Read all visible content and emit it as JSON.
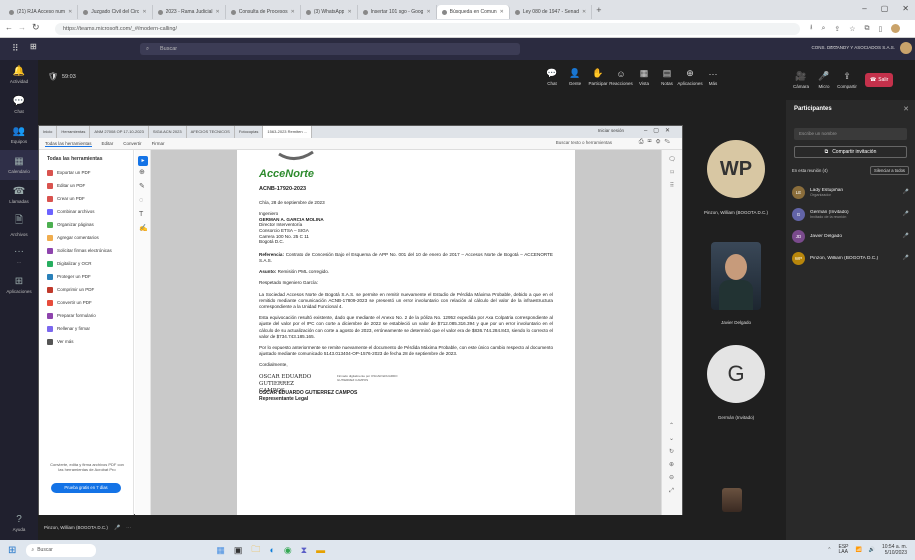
{
  "browser": {
    "tabs": [
      {
        "label": "(21) RJA Acceso num",
        "active": false
      },
      {
        "label": "Juzgado Civil del Circ",
        "active": false
      },
      {
        "label": "2023 - Rama Judicial",
        "active": false
      },
      {
        "label": "Consulta de Procesos",
        "active": false
      },
      {
        "label": "(3) WhatsApp",
        "active": false
      },
      {
        "label": "Insertar 101 sgo - Goog",
        "active": false
      },
      {
        "label": "Búsqueda en Comun",
        "active": true
      },
      {
        "label": "Ley 080 de 1947 - Senad",
        "active": false
      }
    ],
    "url": "https://teams.microsoft.com/_#/modern-calling/"
  },
  "teams": {
    "search_placeholder": "Buscar",
    "org_name": "CONS. DEGANDY Y ASOCIADOS S.A.S.",
    "timer": "59:03",
    "rail": [
      {
        "label": "Actividad",
        "icon": "bell-icon"
      },
      {
        "label": "Chat",
        "icon": "chat-icon"
      },
      {
        "label": "Equipos",
        "icon": "teams-icon"
      },
      {
        "label": "Calendario",
        "icon": "calendar-icon"
      },
      {
        "label": "Llamadas",
        "icon": "phone-icon"
      },
      {
        "label": "Archivos",
        "icon": "file-icon"
      },
      {
        "label": "...",
        "icon": "more-icon"
      },
      {
        "label": "Aplicaciones",
        "icon": "apps-icon"
      }
    ],
    "rail_help": "Ayuda",
    "toolbar": [
      {
        "label": "Chat",
        "icon": "chat-icon"
      },
      {
        "label": "Gente",
        "icon": "people-icon"
      },
      {
        "label": "Participar",
        "icon": "raise-hand-icon"
      },
      {
        "label": "Reacciones",
        "icon": "emoji-icon"
      },
      {
        "label": "Vista",
        "icon": "grid-icon"
      },
      {
        "label": "Notas",
        "icon": "notes-icon"
      },
      {
        "label": "Aplicaciones",
        "icon": "apps-icon"
      },
      {
        "label": "Más",
        "icon": "more-icon"
      }
    ],
    "media": [
      {
        "label": "Cámara",
        "icon": "camera-icon"
      },
      {
        "label": "Micro",
        "icon": "mic-icon"
      },
      {
        "label": "Compartir",
        "icon": "share-icon"
      }
    ],
    "leave_label": "Salir",
    "presenter_bottom": "Pinzon, William (BOGOTA D.C.)",
    "colors": {
      "leave": "#c4314b",
      "accent": "#5b5fc7",
      "acce": "#2e8b2e"
    }
  },
  "participants": {
    "title": "Participantes",
    "search_placeholder": "Escribe un nombre",
    "invite_label": "Compartir invitación",
    "section": "En esta reunión (4)",
    "mute_all": "Silenciar a todos",
    "people": [
      {
        "initials": "LE",
        "name": "Lady Estupiñan",
        "role": "Organizador",
        "color": "#8a6d3b"
      },
      {
        "initials": "G",
        "name": "Germán (Invitado)",
        "role": "Invitado de la reunión",
        "color": "#6264a7"
      },
      {
        "initials": "JD",
        "name": "Javier Delgado",
        "role": "",
        "color": "#7a4a8c"
      },
      {
        "initials": "WP",
        "name": "Pinzon, William (BOGOTA D.C.)",
        "role": "",
        "color": "#b8860b"
      }
    ]
  },
  "tiles": [
    {
      "initials": "WP",
      "name": "Pinzon, William (BOGOTA D.C.)",
      "type": "avatar",
      "color": "#d8c7a3"
    },
    {
      "initials": "",
      "name": "Javier Delgado",
      "type": "video",
      "color": "#556"
    },
    {
      "initials": "G",
      "name": "Germán (Invitado)",
      "type": "avatar",
      "color": "#e4e4e4"
    }
  ],
  "shared": {
    "tabs": [
      "Inicio",
      "Herramientas",
      "ANM 27008 OP 17-10-2023",
      "SIGA ACN 2023",
      "AFECIOS TECNICOS",
      "Fotocopias",
      "1563-2023 Remiten ..."
    ],
    "tab_active": "1563-2023 Remiten ...",
    "login_label": "Iniciar sesión",
    "menu": [
      "Todas las herramientas",
      "Editar",
      "Convertir",
      "Firmar"
    ],
    "find_label": "Buscar texto o herramientas",
    "tools_title": "Todas las herramientas",
    "tools": [
      {
        "label": "Exportar un PDF",
        "color": "#d9534f"
      },
      {
        "label": "Editar un PDF",
        "color": "#d9534f"
      },
      {
        "label": "Crear un PDF",
        "color": "#d9534f"
      },
      {
        "label": "Combinar archivos",
        "color": "#6c63ff"
      },
      {
        "label": "Organizar páginas",
        "color": "#4caf50"
      },
      {
        "label": "Agregar comentarios",
        "color": "#f0ad4e"
      },
      {
        "label": "Solicitar firmas electrónicas",
        "color": "#8e44ad"
      },
      {
        "label": "Digitalizar y OCR",
        "color": "#27ae60"
      },
      {
        "label": "Proteger un PDF",
        "color": "#2980b9"
      },
      {
        "label": "Comprimir un PDF",
        "color": "#c0392b"
      },
      {
        "label": "Convertir un PDF",
        "color": "#e74c3c"
      },
      {
        "label": "Preparar formulario",
        "color": "#8e44ad"
      },
      {
        "label": "Rellenar y firmar",
        "color": "#7b68ee"
      },
      {
        "label": "Ver más",
        "color": "#555"
      }
    ],
    "promo_text": "Convierte, edita y firma archivos PDF con las herramientas de Acrobat Pro",
    "promo_button": "Prueba gratis en 7 días"
  },
  "doc": {
    "logo": "AcceNorte",
    "ref_code": "ACNB-17920-2023",
    "date": "Chía, 28 de septiembre de 2023",
    "addr": [
      "Ingeniero",
      "GERMAN A. GARCIA MOLINA",
      "Director Interventoría",
      "Consorcio ETSA – SIGA",
      "Carrera 100 No. 25 C 11",
      "Bogotá D.C."
    ],
    "ref_label": "Referencia:",
    "ref_text": "Contrato de Concesión Bajo el Esquema de APP No. 001 del 10 de enero de 2017 – Accesos Norte de Bogotá – ACCENORTE S.A.S.",
    "subject_label": "Asunto:",
    "subject_text": "Remisión PML corregido.",
    "greeting": "Respetado Ingeniero García:",
    "p1": "La Sociedad Accesos Norte de Bogotá S.A.S. se permite en remitir nuevamente el Estudio de Pérdida Máxima Probable, debido a que en el remitido mediante comunicación ACNB-17809-2023 se presentó un error involuntario con relación al cálculo del valor de la infraestructura correspondiente a la Unidad Funcional 4.",
    "p2": "Esta equivocación resultó existente, dado que mediante el Anexo No. 2 de la póliza No. 12952 expedida por Axa Colpatria correspondiente al ajuste del valor por el IPC con corte a diciembre de 2022 se estableció un valor de $712.085.316.394 y que por un error involuntario en el cálculo de su actualización con corte a agosto de 2023, erróneamente se determinó que el valor era de $836.744.284.843, siendo lo correcto el valor de $734.743.185.165.",
    "p3": "Por lo expuesto anteriormente se remite nuevamente el documento de Pérdida Máxima Probable, con este único cambio respecto al documento ajustado mediante comunicado 5143.013404-OP-1576-2023 de fecha 28 de septiembre de 2023.",
    "closing": "Cordialmente,",
    "sig_name": "OSCAR EDUARDO GUTIERREZ CAMPOS",
    "sig_role": "Representante Legal",
    "sig_stamp": "Firmado digitalmente por OSCAR EDUARDO GUTIERREZ CAMPOS"
  },
  "taskbar": {
    "search_placeholder": "Buscar",
    "lang": "ESP\nLAA",
    "time": "10:54 a. m.",
    "date": "5/10/2023"
  }
}
